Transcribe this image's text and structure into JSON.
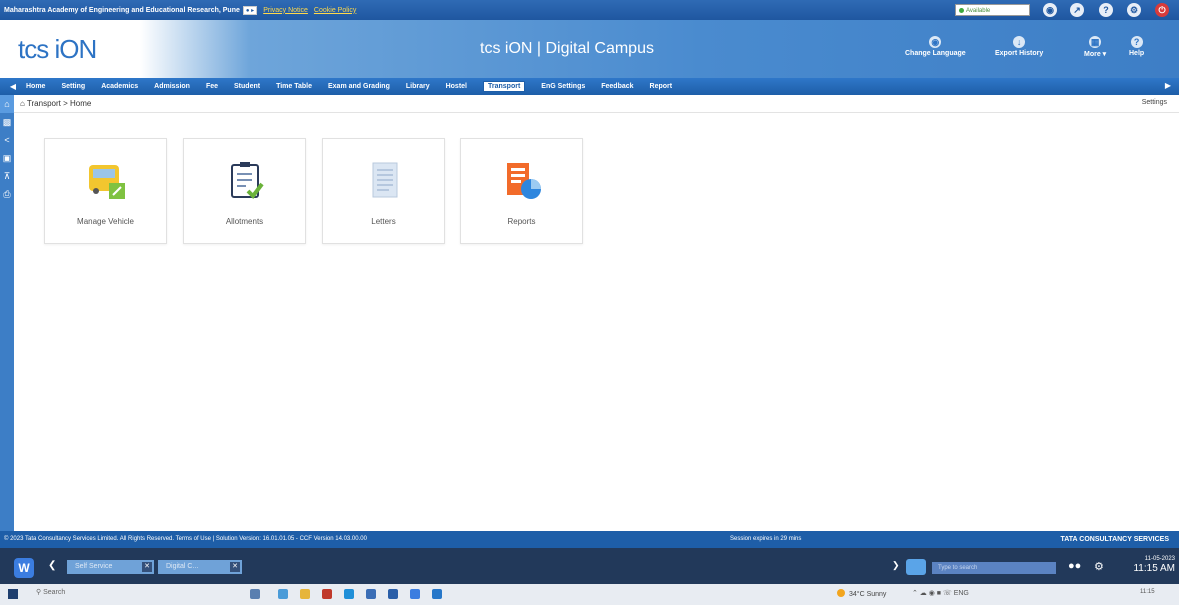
{
  "top_strip": {
    "org": "Maharashtra Academy of Engineering and Educational Research, Pune",
    "privacy": "Privacy Notice",
    "cookie": "Cookie Policy",
    "status": "Available"
  },
  "header": {
    "logo": "tcs iON",
    "title": "tcs iON | Digital Campus",
    "change_language": "Change Language",
    "export_history": "Export History",
    "more": "More",
    "help": "Help"
  },
  "nav": {
    "items": [
      "Home",
      "Setting",
      "Academics",
      "Admission",
      "Fee",
      "Student",
      "Time Table",
      "Exam and Grading",
      "Library",
      "Hostel",
      "Transport",
      "EnG Settings",
      "Feedback",
      "Report"
    ],
    "active": "Transport"
  },
  "breadcrumb": "Transport > Home",
  "settings_link": "Settings",
  "tiles": [
    {
      "label": "Manage Vehicle",
      "icon": "bus-icon"
    },
    {
      "label": "Allotments",
      "icon": "clipboard-check-icon"
    },
    {
      "label": "Letters",
      "icon": "document-icon"
    },
    {
      "label": "Reports",
      "icon": "report-chart-icon"
    }
  ],
  "footer": {
    "copyright": "© 2023 Tata Consultancy Services Limited. All Rights Reserved.   Terms of Use | Solution Version: 16.01.01.05 - CCF Version 14.03.00.00",
    "session": "Session expires in 29 mins",
    "brand": "TATA CONSULTANCY SERVICES"
  },
  "taskbar": {
    "tab1": "Self Service",
    "tab2": "Digital C...",
    "search_placeholder": "Type to search",
    "date": "11-05-2023",
    "time": "11:15 AM",
    "win_search": "Search",
    "weather": "34°C Sunny",
    "lang": "ENG",
    "tray_time": "11:15"
  }
}
